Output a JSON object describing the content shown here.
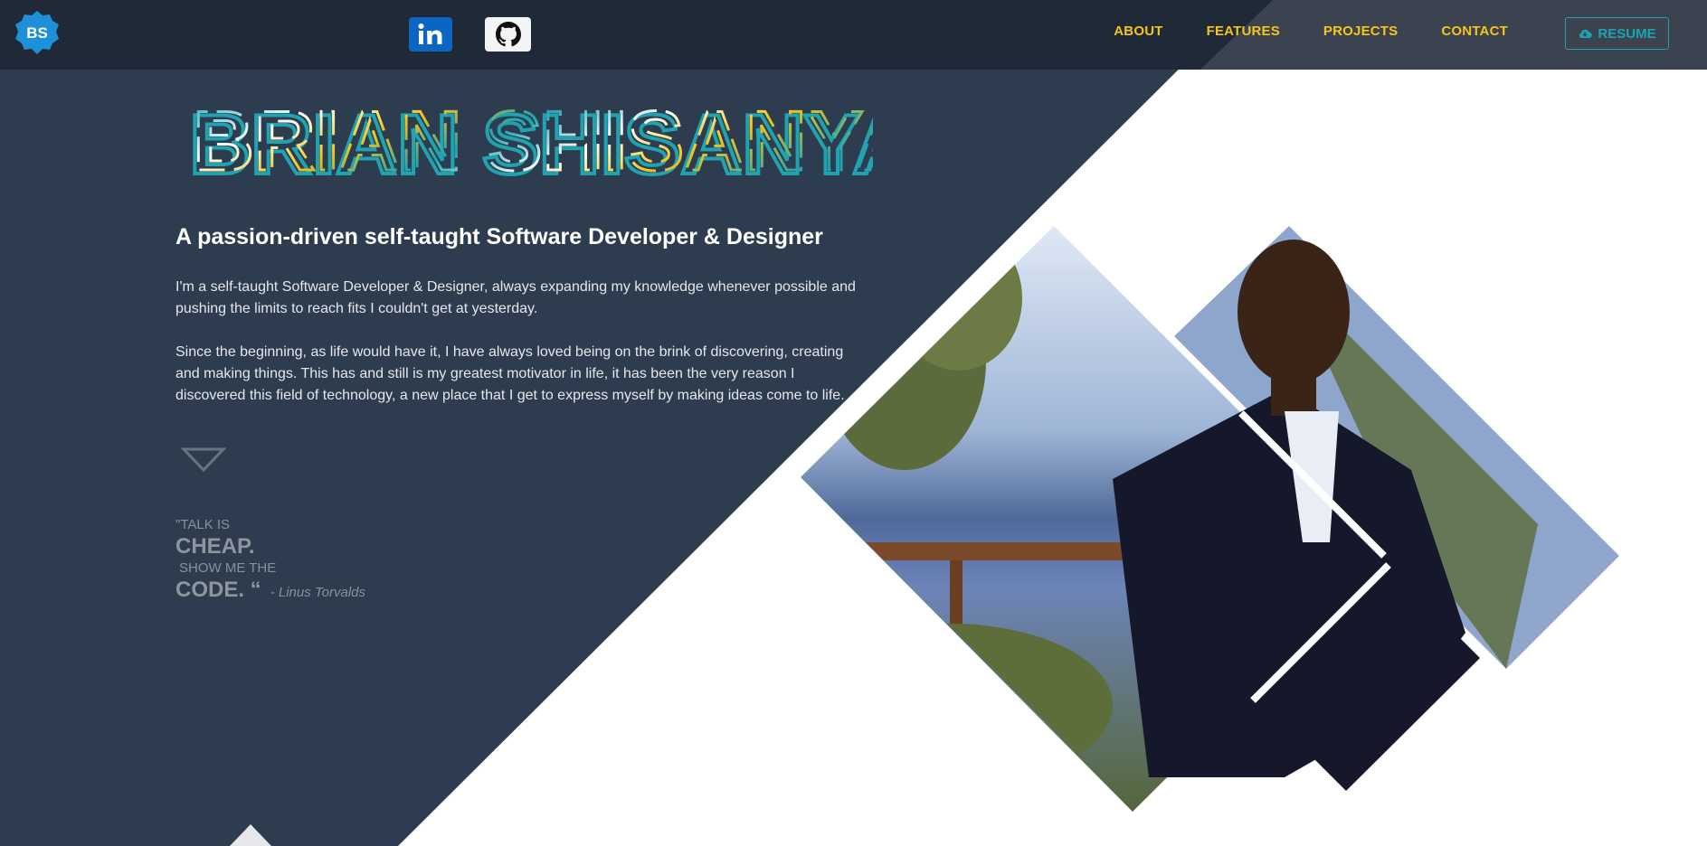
{
  "brand": {
    "logo_text": "BS"
  },
  "social": {
    "linkedin_icon": "linkedin-icon",
    "github_icon": "github-icon"
  },
  "nav": {
    "items": [
      {
        "label": "ABOUT"
      },
      {
        "label": "FEATURES"
      },
      {
        "label": "PROJECTS"
      },
      {
        "label": "CONTACT"
      }
    ],
    "resume_label": "RESUME"
  },
  "hero": {
    "name": "BRIAN SHISANYA",
    "tagline": "A passion-driven self-taught Software Developer & Designer",
    "paragraph1": "I'm a self-taught Software Developer & Designer, always expanding my knowledge whenever possible and pushing the limits to reach fits I couldn't get at yesterday.",
    "paragraph2": "Since the beginning, as life would have it, I have always loved being on the brink of discovering, creating and making things. This has and still is my greatest motivator in life, it has been the very reason I discovered this field of technology, a new place that I get to express myself by making ideas come to life."
  },
  "quote": {
    "line1": "\"TALK IS",
    "line2": "CHEAP.",
    "line3": "SHOW ME THE",
    "line4": "CODE. “",
    "author": "- Linus Torvalds"
  },
  "colors": {
    "dark_bg": "#2e3c4f",
    "navbar": "#1f2937",
    "accent_yellow": "#f5c518",
    "accent_teal": "#1fa3b0",
    "white": "#ffffff"
  }
}
